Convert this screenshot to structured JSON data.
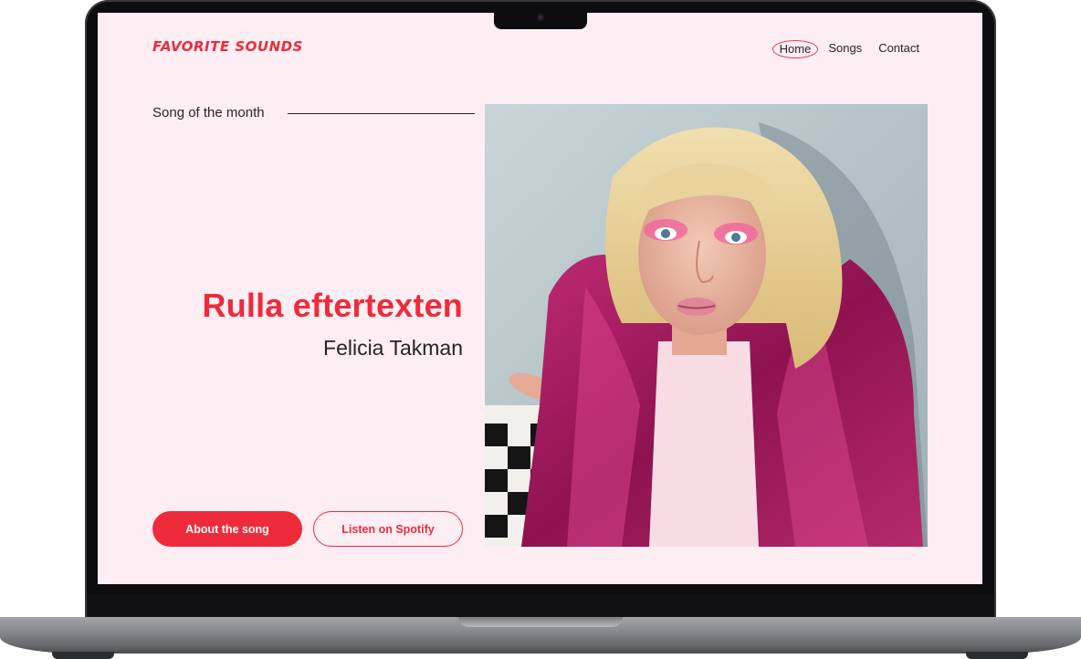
{
  "site": {
    "logo": "FAVORITE SOUNDS"
  },
  "nav": {
    "items": [
      {
        "label": "Home"
      },
      {
        "label": "Songs"
      },
      {
        "label": "Contact"
      }
    ]
  },
  "hero": {
    "section_label": "Song of the month",
    "song_title": "Rulla eftertexten",
    "artist": "Felicia Takman",
    "primary_button": "About the song",
    "secondary_button": "Listen on Spotify"
  },
  "colors": {
    "accent": "#ee2b3b",
    "background": "#fceef3",
    "text": "#2a2326"
  }
}
